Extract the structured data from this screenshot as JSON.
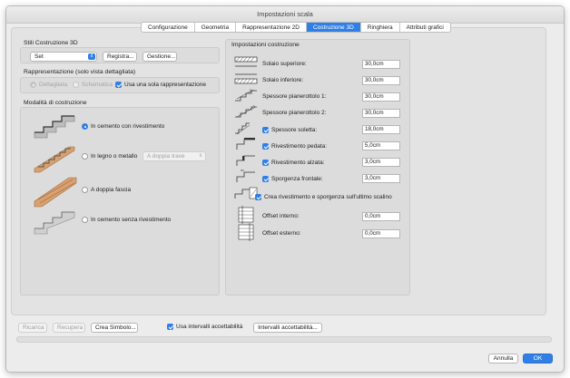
{
  "window": {
    "title": "Impostazioni scala"
  },
  "tabs": [
    {
      "label": "Configurazione"
    },
    {
      "label": "Geometria"
    },
    {
      "label": "Rappresentazione 2D"
    },
    {
      "label": "Costruzione 3D",
      "active": true
    },
    {
      "label": "Ringhiera"
    },
    {
      "label": "Attributi grafici"
    }
  ],
  "left": {
    "styles_title": "Stili Costruzione 3D",
    "style_select": "Set",
    "register_label": "Registra...",
    "manage_label": "Gestione...",
    "representation_title": "Rappresentazione (solo vista dettagliata)",
    "rep_detailed": "Dettagliata",
    "rep_schematic": "Schematica",
    "rep_single": "Usa una sola rappresentazione",
    "modes_title": "Modalità di costruzione",
    "mode_concrete_cladding": "In cemento con rivestimento",
    "mode_wood_metal": "In legno o metallo",
    "mode_wood_metal_select": "A doppia trave",
    "mode_double_band": "A doppia fascia",
    "mode_concrete_bare": "In cemento senza rivestimento"
  },
  "right": {
    "title": "Impostazioni costruzione",
    "params": [
      {
        "label": "Solaio superiore:",
        "value": "30,0cm",
        "checkbox": false
      },
      {
        "label": "Solaio inferiore:",
        "value": "30,0cm",
        "checkbox": false
      },
      {
        "label": "Spessore pianerottolo 1:",
        "value": "30,0cm",
        "checkbox": false
      },
      {
        "label": "Spessore pianerottolo 2:",
        "value": "30,0cm",
        "checkbox": false
      },
      {
        "label": "Spessore soletta:",
        "value": "18,0cm",
        "checkbox": true
      },
      {
        "label": "Rivestimento pedata:",
        "value": "5,0cm",
        "checkbox": true
      },
      {
        "label": "Rivestimento alzata:",
        "value": "3,0cm",
        "checkbox": true
      },
      {
        "label": "Sporgenza frontale:",
        "value": "3,0cm",
        "checkbox": true
      }
    ],
    "last_tread_label": "Crea rivestimento e sporgenza sull'ultimo scalino",
    "offsets": [
      {
        "label": "Offset interno:",
        "value": "0,0cm"
      },
      {
        "label": "Offset esterno:",
        "value": "0,0cm"
      }
    ]
  },
  "footer": {
    "reload_label": "Ricarica",
    "restore_label": "Recupera",
    "create_symbol_label": "Crea Simbolo...",
    "tolerance_label": "Usa intervalli accettabilità",
    "tolerance_button_label": "Intervalli accettabilità...",
    "cancel_label": "Annulla",
    "ok_label": "OK"
  },
  "colors": {
    "accent": "#2f7fe6",
    "wood": "#d9a070"
  }
}
